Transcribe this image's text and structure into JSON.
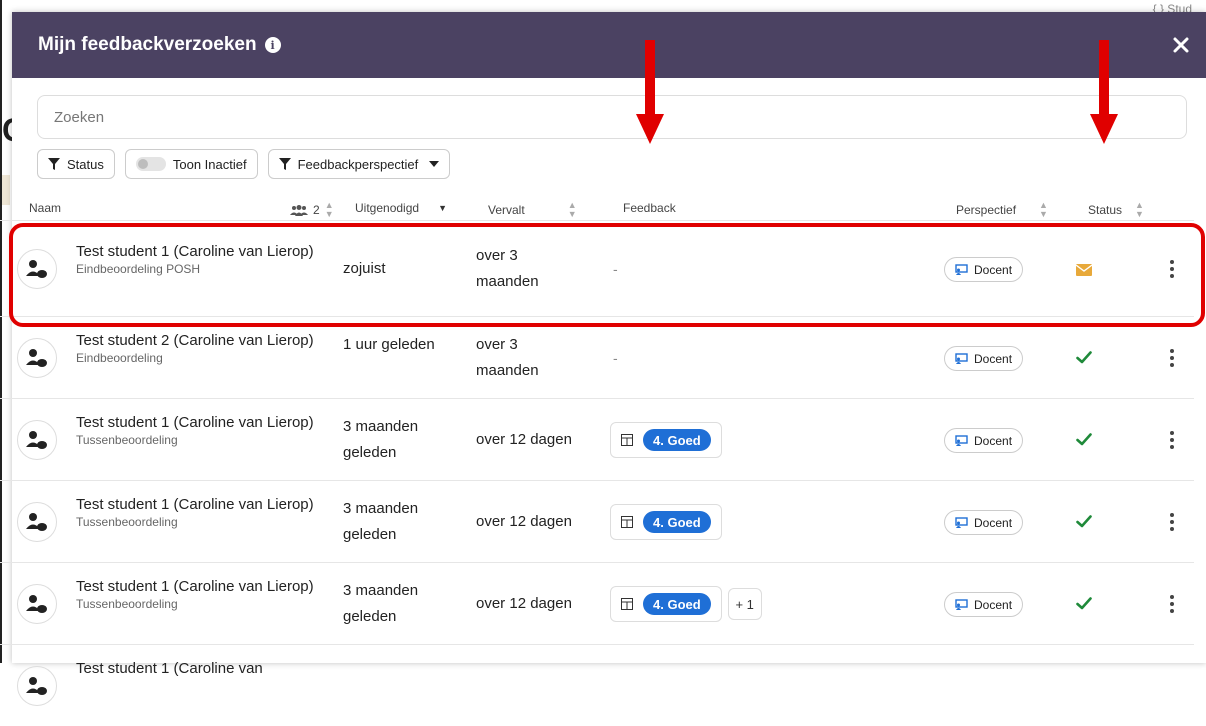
{
  "background": {
    "right_label": "{ } Stud",
    "left_char": "C"
  },
  "modal": {
    "title": "Mijn feedbackverzoeken",
    "close_label": "×"
  },
  "search": {
    "placeholder": "Zoeken"
  },
  "filters": {
    "status_label": "Status",
    "inactive_label": "Toon Inactief",
    "perspective_label": "Feedbackperspectief"
  },
  "columns": {
    "name": "Naam",
    "count": "2",
    "invited": "Uitgenodigd",
    "expires": "Vervalt",
    "feedback": "Feedback",
    "perspective": "Perspectief",
    "status": "Status"
  },
  "rows": [
    {
      "name": "Test student 1 (Caroline van Lierop)",
      "assessment": "Eindbeoordeling POSH",
      "invited": "zojuist",
      "expires": "over 3 maanden",
      "feedback": "-",
      "grade": "",
      "extra": "",
      "perspective": "Docent",
      "status": "pending"
    },
    {
      "name": "Test student 2 (Caroline van Lierop)",
      "assessment": "Eindbeoordeling",
      "invited": "1 uur geleden",
      "expires": "over 3 maanden",
      "feedback": "-",
      "grade": "",
      "extra": "",
      "perspective": "Docent",
      "status": "done"
    },
    {
      "name": "Test student 1 (Caroline van Lierop)",
      "assessment": "Tussenbeoordeling",
      "invited": "3 maanden geleden",
      "expires": "over 12 dagen",
      "feedback": "",
      "grade": "4. Goed",
      "extra": "",
      "perspective": "Docent",
      "status": "done"
    },
    {
      "name": "Test student 1 (Caroline van Lierop)",
      "assessment": "Tussenbeoordeling",
      "invited": "3 maanden geleden",
      "expires": "over 12 dagen",
      "feedback": "",
      "grade": "4. Goed",
      "extra": "",
      "perspective": "Docent",
      "status": "done"
    },
    {
      "name": "Test student 1 (Caroline van Lierop)",
      "assessment": "Tussenbeoordeling",
      "invited": "3 maanden geleden",
      "expires": "over 12 dagen",
      "feedback": "",
      "grade": "4. Goed",
      "extra": "+ 1",
      "perspective": "Docent",
      "status": "done"
    },
    {
      "name": "Test student 1 (Caroline van",
      "assessment": "",
      "invited": "",
      "expires": "",
      "feedback": "",
      "grade": "",
      "extra": "",
      "perspective": "",
      "status": ""
    }
  ],
  "icons": {
    "filter": "filter-icon",
    "info": "info-icon",
    "close": "close-icon",
    "person": "person-chat-icon",
    "grid": "grid-icon",
    "perspective": "teacher-icon",
    "pending": "envelope-icon",
    "done": "check-icon",
    "menu": "kebab-menu-icon",
    "arrow": "down-arrow-icon"
  },
  "colors": {
    "header": "#4b4262",
    "accent_blue": "#1f6fd6",
    "status_pending": "#e8a93a",
    "status_done": "#1f8a3a",
    "annotation": "#e00000"
  }
}
